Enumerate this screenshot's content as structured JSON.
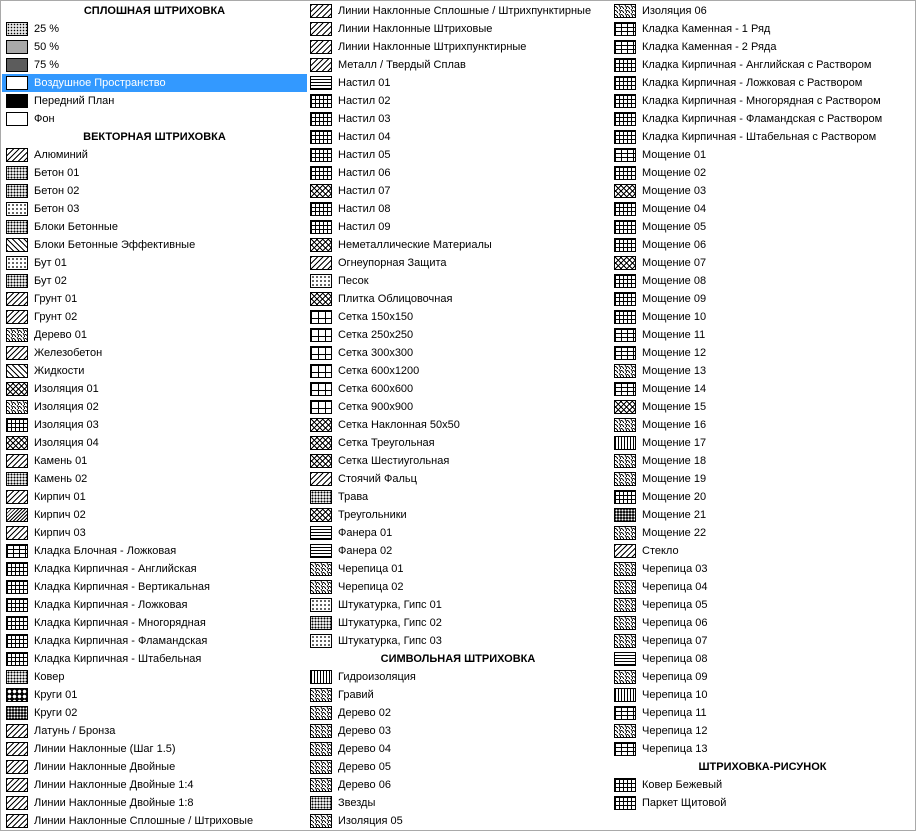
{
  "columns": [
    [
      {
        "type": "header",
        "label": "СПЛОШНАЯ ШТРИХОВКА"
      },
      {
        "type": "item",
        "label": "25 %",
        "pattern": "g25"
      },
      {
        "type": "item",
        "label": "50 %",
        "pattern": "g50"
      },
      {
        "type": "item",
        "label": "75 %",
        "pattern": "g75"
      },
      {
        "type": "item",
        "label": "Воздушное Пространство",
        "pattern": "white",
        "selected": true
      },
      {
        "type": "item",
        "label": "Передний План",
        "pattern": "black"
      },
      {
        "type": "item",
        "label": "Фон",
        "pattern": "white"
      },
      {
        "type": "header",
        "label": "ВЕКТОРНАЯ ШТРИХОВКА"
      },
      {
        "type": "item",
        "label": "Алюминий",
        "pattern": "diag"
      },
      {
        "type": "item",
        "label": "Бетон 01",
        "pattern": "dots"
      },
      {
        "type": "item",
        "label": "Бетон 02",
        "pattern": "dots"
      },
      {
        "type": "item",
        "label": "Бетон 03",
        "pattern": "dots-s"
      },
      {
        "type": "item",
        "label": "Блоки Бетонные",
        "pattern": "dots"
      },
      {
        "type": "item",
        "label": "Блоки Бетонные Эффективные",
        "pattern": "diag2"
      },
      {
        "type": "item",
        "label": "Бут 01",
        "pattern": "dots-s"
      },
      {
        "type": "item",
        "label": "Бут 02",
        "pattern": "dots"
      },
      {
        "type": "item",
        "label": "Грунт 01",
        "pattern": "diag"
      },
      {
        "type": "item",
        "label": "Грунт 02",
        "pattern": "diag"
      },
      {
        "type": "item",
        "label": "Дерево 01",
        "pattern": "wave"
      },
      {
        "type": "item",
        "label": "Железобетон",
        "pattern": "diag"
      },
      {
        "type": "item",
        "label": "Жидкости",
        "pattern": "diag2"
      },
      {
        "type": "item",
        "label": "Изоляция 01",
        "pattern": "cross"
      },
      {
        "type": "item",
        "label": "Изоляция 02",
        "pattern": "wave"
      },
      {
        "type": "item",
        "label": "Изоляция 03",
        "pattern": "grid-s"
      },
      {
        "type": "item",
        "label": "Изоляция 04",
        "pattern": "cross"
      },
      {
        "type": "item",
        "label": "Камень 01",
        "pattern": "diag"
      },
      {
        "type": "item",
        "label": "Камень 02",
        "pattern": "dots"
      },
      {
        "type": "item",
        "label": "Кирпич 01",
        "pattern": "diag"
      },
      {
        "type": "item",
        "label": "Кирпич 02",
        "pattern": "diagdense"
      },
      {
        "type": "item",
        "label": "Кирпич 03",
        "pattern": "diag"
      },
      {
        "type": "item",
        "label": "Кладка Блочная - Ложковая",
        "pattern": "brick"
      },
      {
        "type": "item",
        "label": "Кладка Кирпичная - Английская",
        "pattern": "grid-s"
      },
      {
        "type": "item",
        "label": "Кладка Кирпичная - Вертикальная",
        "pattern": "grid-s"
      },
      {
        "type": "item",
        "label": "Кладка Кирпичная - Ложковая",
        "pattern": "grid-s"
      },
      {
        "type": "item",
        "label": "Кладка Кирпичная - Многорядная",
        "pattern": "grid-s"
      },
      {
        "type": "item",
        "label": "Кладка Кирпичная - Фламандская",
        "pattern": "grid-s"
      },
      {
        "type": "item",
        "label": "Кладка Кирпичная - Штабельная",
        "pattern": "grid-s"
      },
      {
        "type": "item",
        "label": "Ковер",
        "pattern": "dots"
      },
      {
        "type": "item",
        "label": "Круги 01",
        "pattern": "circles"
      },
      {
        "type": "item",
        "label": "Круги 02",
        "pattern": "dark"
      },
      {
        "type": "item",
        "label": "Латунь / Бронза",
        "pattern": "diag"
      },
      {
        "type": "item",
        "label": "Линии Наклонные (Шаг 1.5)",
        "pattern": "diag"
      },
      {
        "type": "item",
        "label": "Линии Наклонные Двойные",
        "pattern": "diag"
      },
      {
        "type": "item",
        "label": "Линии Наклонные Двойные 1:4",
        "pattern": "diag"
      },
      {
        "type": "item",
        "label": "Линии Наклонные Двойные 1:8",
        "pattern": "diag"
      },
      {
        "type": "item",
        "label": "Линии Наклонные Сплошные / Штриховые",
        "pattern": "diag"
      }
    ],
    [
      {
        "type": "item",
        "label": "Линии Наклонные Сплошные / Штрихпунктирные",
        "pattern": "diag"
      },
      {
        "type": "item",
        "label": "Линии Наклонные Штриховые",
        "pattern": "diag"
      },
      {
        "type": "item",
        "label": "Линии Наклонные Штрихпунктирные",
        "pattern": "diag"
      },
      {
        "type": "item",
        "label": "Металл / Твердый Сплав",
        "pattern": "diag"
      },
      {
        "type": "item",
        "label": "Настил 01",
        "pattern": "horiz"
      },
      {
        "type": "item",
        "label": "Настил 02",
        "pattern": "grid-s"
      },
      {
        "type": "item",
        "label": "Настил 03",
        "pattern": "grid-s"
      },
      {
        "type": "item",
        "label": "Настил 04",
        "pattern": "grid-s"
      },
      {
        "type": "item",
        "label": "Настил 05",
        "pattern": "grid-s"
      },
      {
        "type": "item",
        "label": "Настил 06",
        "pattern": "grid-s"
      },
      {
        "type": "item",
        "label": "Настил 07",
        "pattern": "cross"
      },
      {
        "type": "item",
        "label": "Настил 08",
        "pattern": "grid-s"
      },
      {
        "type": "item",
        "label": "Настил 09",
        "pattern": "grid-s"
      },
      {
        "type": "item",
        "label": "Неметаллические Материалы",
        "pattern": "cross"
      },
      {
        "type": "item",
        "label": "Огнеупорная Защита",
        "pattern": "diag"
      },
      {
        "type": "item",
        "label": "Песок",
        "pattern": "dots-s"
      },
      {
        "type": "item",
        "label": "Плитка Облицовочная",
        "pattern": "cross"
      },
      {
        "type": "item",
        "label": "Сетка 150x150",
        "pattern": "grid"
      },
      {
        "type": "item",
        "label": "Сетка 250x250",
        "pattern": "grid"
      },
      {
        "type": "item",
        "label": "Сетка 300x300",
        "pattern": "grid"
      },
      {
        "type": "item",
        "label": "Сетка 600x1200",
        "pattern": "grid"
      },
      {
        "type": "item",
        "label": "Сетка 600x600",
        "pattern": "grid"
      },
      {
        "type": "item",
        "label": "Сетка 900x900",
        "pattern": "grid"
      },
      {
        "type": "item",
        "label": "Сетка Наклонная 50x50",
        "pattern": "cross"
      },
      {
        "type": "item",
        "label": "Сетка Треугольная",
        "pattern": "cross"
      },
      {
        "type": "item",
        "label": "Сетка Шестиугольная",
        "pattern": "cross"
      },
      {
        "type": "item",
        "label": "Стоячий Фальц",
        "pattern": "diag"
      },
      {
        "type": "item",
        "label": "Трава",
        "pattern": "dots"
      },
      {
        "type": "item",
        "label": "Треугольники",
        "pattern": "cross"
      },
      {
        "type": "item",
        "label": "Фанера 01",
        "pattern": "horiz"
      },
      {
        "type": "item",
        "label": "Фанера 02",
        "pattern": "horiz"
      },
      {
        "type": "item",
        "label": "Черепица 01",
        "pattern": "wave"
      },
      {
        "type": "item",
        "label": "Черепица 02",
        "pattern": "wave"
      },
      {
        "type": "item",
        "label": "Штукатурка, Гипс 01",
        "pattern": "dots-s"
      },
      {
        "type": "item",
        "label": "Штукатурка, Гипс 02",
        "pattern": "dots"
      },
      {
        "type": "item",
        "label": "Штукатурка, Гипс 03",
        "pattern": "dots-s"
      },
      {
        "type": "header",
        "label": "СИМВОЛЬНАЯ ШТРИХОВКА"
      },
      {
        "type": "item",
        "label": "Гидроизоляция",
        "pattern": "vert"
      },
      {
        "type": "item",
        "label": "Гравий",
        "pattern": "wave"
      },
      {
        "type": "item",
        "label": "Дерево 02",
        "pattern": "wave"
      },
      {
        "type": "item",
        "label": "Дерево 03",
        "pattern": "wave"
      },
      {
        "type": "item",
        "label": "Дерево 04",
        "pattern": "wave"
      },
      {
        "type": "item",
        "label": "Дерево 05",
        "pattern": "wave"
      },
      {
        "type": "item",
        "label": "Дерево 06",
        "pattern": "wave"
      },
      {
        "type": "item",
        "label": "Звезды",
        "pattern": "dots"
      },
      {
        "type": "item",
        "label": "Изоляция 05",
        "pattern": "wave"
      }
    ],
    [
      {
        "type": "item",
        "label": "Изоляция 06",
        "pattern": "wave"
      },
      {
        "type": "item",
        "label": "Кладка Каменная - 1 Ряд",
        "pattern": "brick"
      },
      {
        "type": "item",
        "label": "Кладка Каменная - 2 Ряда",
        "pattern": "brick"
      },
      {
        "type": "item",
        "label": "Кладка Кирпичная - Английская с Раствором",
        "pattern": "grid-s"
      },
      {
        "type": "item",
        "label": "Кладка Кирпичная - Ложковая с Раствором",
        "pattern": "grid-s"
      },
      {
        "type": "item",
        "label": "Кладка Кирпичная - Многорядная с Раствором",
        "pattern": "grid-s"
      },
      {
        "type": "item",
        "label": "Кладка Кирпичная - Фламандская с Раствором",
        "pattern": "grid-s"
      },
      {
        "type": "item",
        "label": "Кладка Кирпичная - Штабельная с Раствором",
        "pattern": "grid-s"
      },
      {
        "type": "item",
        "label": "Мощение 01",
        "pattern": "brick"
      },
      {
        "type": "item",
        "label": "Мощение 02",
        "pattern": "grid-s"
      },
      {
        "type": "item",
        "label": "Мощение 03",
        "pattern": "cross"
      },
      {
        "type": "item",
        "label": "Мощение 04",
        "pattern": "grid-s"
      },
      {
        "type": "item",
        "label": "Мощение 05",
        "pattern": "grid-s"
      },
      {
        "type": "item",
        "label": "Мощение 06",
        "pattern": "grid-s"
      },
      {
        "type": "item",
        "label": "Мощение 07",
        "pattern": "cross"
      },
      {
        "type": "item",
        "label": "Мощение 08",
        "pattern": "grid-s"
      },
      {
        "type": "item",
        "label": "Мощение 09",
        "pattern": "grid-s"
      },
      {
        "type": "item",
        "label": "Мощение 10",
        "pattern": "grid-s"
      },
      {
        "type": "item",
        "label": "Мощение 11",
        "pattern": "brick"
      },
      {
        "type": "item",
        "label": "Мощение 12",
        "pattern": "brick"
      },
      {
        "type": "item",
        "label": "Мощение 13",
        "pattern": "wave"
      },
      {
        "type": "item",
        "label": "Мощение 14",
        "pattern": "brick"
      },
      {
        "type": "item",
        "label": "Мощение 15",
        "pattern": "cross"
      },
      {
        "type": "item",
        "label": "Мощение 16",
        "pattern": "wave"
      },
      {
        "type": "item",
        "label": "Мощение 17",
        "pattern": "vert"
      },
      {
        "type": "item",
        "label": "Мощение 18",
        "pattern": "wave"
      },
      {
        "type": "item",
        "label": "Мощение 19",
        "pattern": "wave"
      },
      {
        "type": "item",
        "label": "Мощение 20",
        "pattern": "grid-s"
      },
      {
        "type": "item",
        "label": "Мощение 21",
        "pattern": "dark"
      },
      {
        "type": "item",
        "label": "Мощение 22",
        "pattern": "wave"
      },
      {
        "type": "item",
        "label": "Стекло",
        "pattern": "diag"
      },
      {
        "type": "item",
        "label": "Черепица 03",
        "pattern": "wave"
      },
      {
        "type": "item",
        "label": "Черепица 04",
        "pattern": "wave"
      },
      {
        "type": "item",
        "label": "Черепица 05",
        "pattern": "wave"
      },
      {
        "type": "item",
        "label": "Черепица 06",
        "pattern": "wave"
      },
      {
        "type": "item",
        "label": "Черепица 07",
        "pattern": "wave"
      },
      {
        "type": "item",
        "label": "Черепица 08",
        "pattern": "horiz"
      },
      {
        "type": "item",
        "label": "Черепица 09",
        "pattern": "wave"
      },
      {
        "type": "item",
        "label": "Черепица 10",
        "pattern": "vert"
      },
      {
        "type": "item",
        "label": "Черепица 11",
        "pattern": "brick"
      },
      {
        "type": "item",
        "label": "Черепица 12",
        "pattern": "wave"
      },
      {
        "type": "item",
        "label": "Черепица 13",
        "pattern": "brick"
      },
      {
        "type": "header",
        "label": "ШТРИХОВКА-РИСУНОК"
      },
      {
        "type": "item",
        "label": "Ковер Бежевый",
        "pattern": "grid-s"
      },
      {
        "type": "item",
        "label": "Паркет Щитовой",
        "pattern": "grid-s"
      }
    ]
  ]
}
